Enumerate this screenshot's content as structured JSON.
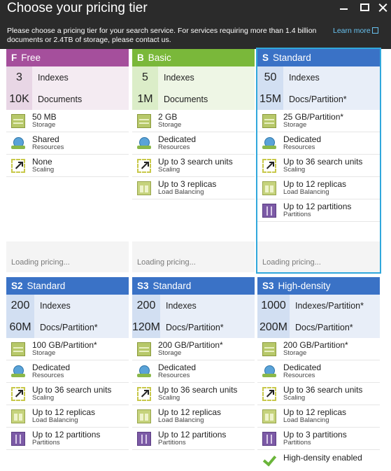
{
  "header": {
    "title": "Choose your pricing tier",
    "description": "Please choose a pricing tier for your search service. For services requiring more than 1.4 billion documents or 2.4TB of storage, please contact us.",
    "learn_more": "Learn more"
  },
  "colors": {
    "header_bg": "#2b2b2b",
    "free": "#a54f9c",
    "basic": "#7ab83a",
    "standard": "#3a72c6",
    "selected_outline": "#30a8dc"
  },
  "tiers": [
    {
      "code": "F",
      "name": "Free",
      "indexes": {
        "value": "3",
        "label": "Indexes"
      },
      "documents": {
        "value": "10K",
        "label": "Documents"
      },
      "features": [
        {
          "icon": "storage-icon",
          "main": "50 MB",
          "sub": "Storage"
        },
        {
          "icon": "resource-icon",
          "main": "Shared",
          "sub": "Resources"
        },
        {
          "icon": "scaling-icon",
          "main": "None",
          "sub": "Scaling"
        }
      ],
      "loading": "Loading pricing..."
    },
    {
      "code": "B",
      "name": "Basic",
      "indexes": {
        "value": "5",
        "label": "Indexes"
      },
      "documents": {
        "value": "1M",
        "label": "Documents"
      },
      "features": [
        {
          "icon": "storage-icon",
          "main": "2 GB",
          "sub": "Storage"
        },
        {
          "icon": "resource-icon",
          "main": "Dedicated",
          "sub": "Resources"
        },
        {
          "icon": "scaling-icon",
          "main": "Up to 3 search units",
          "sub": "Scaling"
        },
        {
          "icon": "replica-icon",
          "main": "Up to 3 replicas",
          "sub": "Load Balancing"
        }
      ],
      "loading": "Loading pricing..."
    },
    {
      "code": "S",
      "name": "Standard",
      "indexes": {
        "value": "50",
        "label": "Indexes"
      },
      "documents": {
        "value": "15M",
        "label": "Docs/Partition*"
      },
      "features": [
        {
          "icon": "storage-icon",
          "main": "25 GB/Partition*",
          "sub": "Storage"
        },
        {
          "icon": "resource-icon",
          "main": "Dedicated",
          "sub": "Resources"
        },
        {
          "icon": "scaling-icon",
          "main": "Up to 36 search units",
          "sub": "Scaling"
        },
        {
          "icon": "replica-icon",
          "main": "Up to 12 replicas",
          "sub": "Load Balancing"
        },
        {
          "icon": "partition-icon",
          "main": "Up to 12 partitions",
          "sub": "Partitions"
        }
      ],
      "loading": "Loading pricing..."
    },
    {
      "code": "S2",
      "name": "Standard",
      "indexes": {
        "value": "200",
        "label": "Indexes"
      },
      "documents": {
        "value": "60M",
        "label": "Docs/Partition*"
      },
      "features": [
        {
          "icon": "storage-icon",
          "main": "100 GB/Partition*",
          "sub": "Storage"
        },
        {
          "icon": "resource-icon",
          "main": "Dedicated",
          "sub": "Resources"
        },
        {
          "icon": "scaling-icon",
          "main": "Up to 36 search units",
          "sub": "Scaling"
        },
        {
          "icon": "replica-icon",
          "main": "Up to 12 replicas",
          "sub": "Load Balancing"
        },
        {
          "icon": "partition-icon",
          "main": "Up to 12 partitions",
          "sub": "Partitions"
        }
      ]
    },
    {
      "code": "S3",
      "name": "Standard",
      "indexes": {
        "value": "200",
        "label": "Indexes"
      },
      "documents": {
        "value": "120M",
        "label": "Docs/Partition*"
      },
      "features": [
        {
          "icon": "storage-icon",
          "main": "200 GB/Partition*",
          "sub": "Storage"
        },
        {
          "icon": "resource-icon",
          "main": "Dedicated",
          "sub": "Resources"
        },
        {
          "icon": "scaling-icon",
          "main": "Up to 36 search units",
          "sub": "Scaling"
        },
        {
          "icon": "replica-icon",
          "main": "Up to 12 replicas",
          "sub": "Load Balancing"
        },
        {
          "icon": "partition-icon",
          "main": "Up to 12 partitions",
          "sub": "Partitions"
        }
      ]
    },
    {
      "code": "S3",
      "name": "High-density",
      "indexes": {
        "value": "1000",
        "label": "Indexes/Partition*"
      },
      "documents": {
        "value": "200M",
        "label": "Docs/Partition*"
      },
      "features": [
        {
          "icon": "storage-icon",
          "main": "200 GB/Partition*",
          "sub": "Storage"
        },
        {
          "icon": "resource-icon",
          "main": "Dedicated",
          "sub": "Resources"
        },
        {
          "icon": "scaling-icon",
          "main": "Up to 36 search units",
          "sub": "Scaling"
        },
        {
          "icon": "replica-icon",
          "main": "Up to 12 replicas",
          "sub": "Load Balancing"
        },
        {
          "icon": "partition-icon",
          "main": "Up to 3 partitions",
          "sub": "Partitions"
        },
        {
          "icon": "check-icon",
          "main": "High-density enabled",
          "sub": ""
        }
      ]
    }
  ]
}
